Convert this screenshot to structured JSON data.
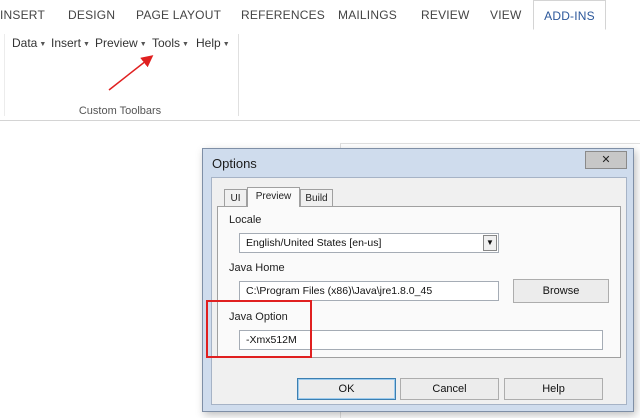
{
  "ribbon": {
    "tabs": [
      {
        "label": "INSERT"
      },
      {
        "label": "DESIGN"
      },
      {
        "label": "PAGE LAYOUT"
      },
      {
        "label": "REFERENCES"
      },
      {
        "label": "MAILINGS"
      },
      {
        "label": "REVIEW"
      },
      {
        "label": "VIEW"
      },
      {
        "label": "ADD-INS"
      }
    ],
    "active_tab": "ADD-INS",
    "menus": [
      {
        "label": "Data"
      },
      {
        "label": "Insert"
      },
      {
        "label": "Preview"
      },
      {
        "label": "Tools"
      },
      {
        "label": "Help"
      }
    ],
    "group_label": "Custom Toolbars"
  },
  "dialog": {
    "title": "Options",
    "close_symbol": "✕",
    "tabs": [
      {
        "label": "UI"
      },
      {
        "label": "Preview"
      },
      {
        "label": "Build"
      }
    ],
    "selected_tab": "Preview",
    "locale": {
      "label": "Locale",
      "value": "English/United States [en-us]"
    },
    "java_home": {
      "label": "Java Home",
      "value": "C:\\Program Files (x86)\\Java\\jre1.8.0_45",
      "browse_label": "Browse"
    },
    "java_option": {
      "label": "Java Option",
      "value": "-Xmx512M"
    },
    "buttons": {
      "ok": "OK",
      "cancel": "Cancel",
      "help": "Help"
    }
  },
  "annotation": {
    "color": "#e02020"
  }
}
